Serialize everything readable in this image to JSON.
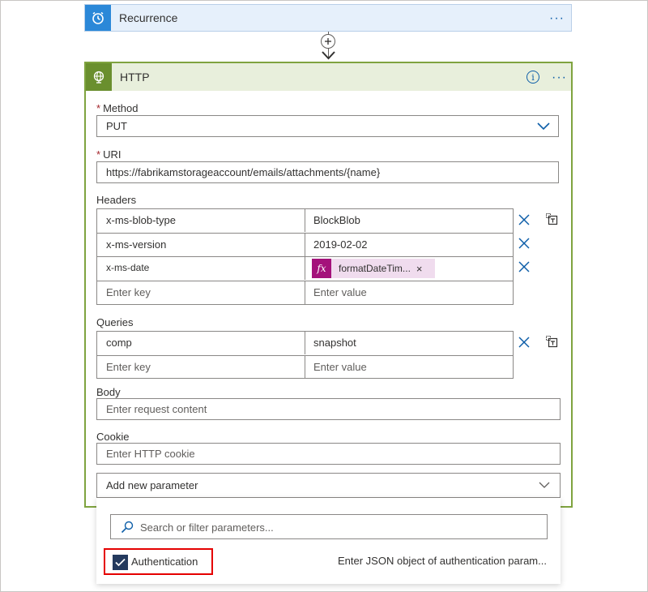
{
  "recurrence": {
    "title": "Recurrence",
    "more": "···",
    "icon": "clock-icon"
  },
  "connector": {
    "add_icon": "plus-icon"
  },
  "http": {
    "title": "HTTP",
    "icon": "globe-icon",
    "more": "···",
    "info": "i",
    "method": {
      "label": "Method",
      "value": "PUT"
    },
    "uri": {
      "label": "URI",
      "value": "https://fabrikamstorageaccount/emails/attachments/{name}"
    },
    "headers": {
      "label": "Headers",
      "rows": [
        {
          "key": "x-ms-blob-type",
          "value": "BlockBlob"
        },
        {
          "key": "x-ms-version",
          "value": "2019-02-02"
        },
        {
          "key": "x-ms-date",
          "token": "formatDateTim...",
          "token_icon": "fx"
        }
      ],
      "key_placeholder": "Enter key",
      "value_placeholder": "Enter value"
    },
    "queries": {
      "label": "Queries",
      "rows": [
        {
          "key": "comp",
          "value": "snapshot"
        }
      ],
      "key_placeholder": "Enter key",
      "value_placeholder": "Enter value"
    },
    "body": {
      "label": "Body",
      "placeholder": "Enter request content"
    },
    "cookie": {
      "label": "Cookie",
      "placeholder": "Enter HTTP cookie"
    },
    "add_param": {
      "label": "Add new parameter"
    }
  },
  "dropdown": {
    "search_placeholder": "Search or filter parameters...",
    "items": [
      {
        "label": "Authentication",
        "checked": true,
        "description": "Enter JSON object of authentication param..."
      }
    ]
  },
  "colors": {
    "recurrence_accent": "#2b88d8",
    "http_accent": "#6a8f2e",
    "token_accent": "#a4127b",
    "highlight": "#e50000"
  }
}
